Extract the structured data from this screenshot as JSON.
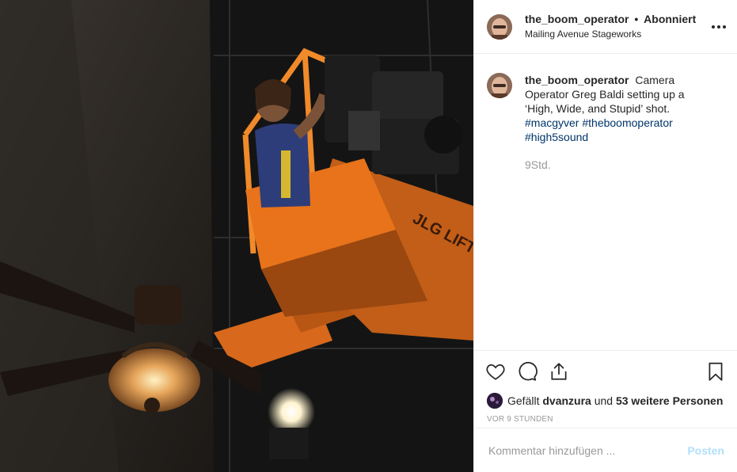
{
  "post": {
    "username": "the_boom_operator",
    "separator": "•",
    "follow_status": "Abonniert",
    "location": "Mailing Avenue Stageworks"
  },
  "caption": {
    "username": "the_boom_operator",
    "text": "Camera Operator Greg Baldi setting up a ‘High, Wide, and Stupid’ shot.",
    "hashtags": [
      "#macgyver",
      "#theboomoperator",
      "#high5sound"
    ],
    "time": "9Std."
  },
  "photo": {
    "lift_text": "JLG LIFT",
    "description_icon": "photo"
  },
  "actions": {
    "like_icon": "heart-icon",
    "comment_icon": "comment-icon",
    "share_icon": "share-icon",
    "save_icon": "bookmark-icon"
  },
  "likes": {
    "prefix": "Gefällt",
    "user": "dvanzura",
    "connector": "und",
    "others": "53 weitere Personen"
  },
  "posted_ago": "VOR 9 STUNDEN",
  "add_comment": {
    "placeholder": "Kommentar hinzufügen ...",
    "post_label": "Posten"
  },
  "colors": {
    "hashtag": "#003569",
    "muted": "#999999",
    "post_button": "#b2dffc",
    "lift_orange": "#e8731a"
  }
}
